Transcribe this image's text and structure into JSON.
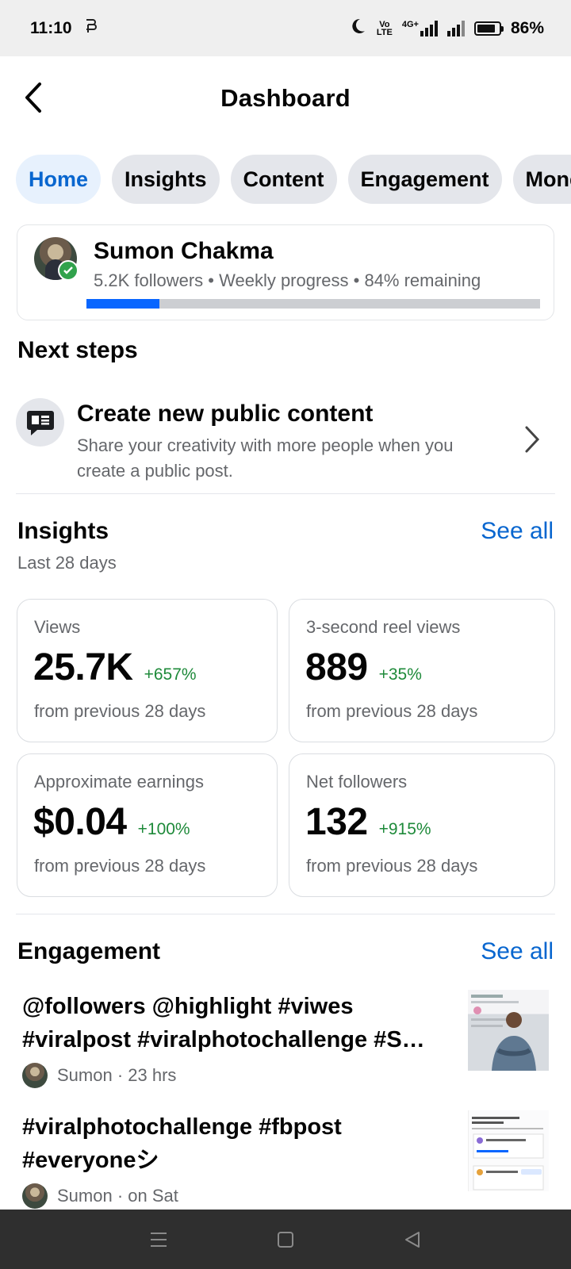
{
  "status_bar": {
    "time": "11:10",
    "volte": "Vo",
    "lte": "LTE",
    "network": "4G+",
    "battery": "86%",
    "battery_level": 0.86
  },
  "header": {
    "title": "Dashboard"
  },
  "tabs": [
    {
      "label": "Home",
      "active": true
    },
    {
      "label": "Insights",
      "active": false
    },
    {
      "label": "Content",
      "active": false
    },
    {
      "label": "Engagement",
      "active": false
    },
    {
      "label": "Mone",
      "active": false
    }
  ],
  "profile": {
    "name": "Sumon Chakma",
    "subtitle": "5.2K followers • Weekly progress • 84% remaining",
    "progress_fraction": 0.16
  },
  "next_steps": {
    "title": "Next steps",
    "item": {
      "title": "Create new public content",
      "description": "Share your creativity with more people when you create a public post."
    }
  },
  "insights": {
    "title": "Insights",
    "see_all": "See all",
    "period": "Last 28 days",
    "metrics": [
      {
        "label": "Views",
        "value": "25.7K",
        "change": "+657%",
        "foot": "from previous 28 days"
      },
      {
        "label": "3-second reel views",
        "value": "889",
        "change": "+35%",
        "foot": "from previous 28 days"
      },
      {
        "label": "Approximate earnings",
        "value": "$0.04",
        "change": "+100%",
        "foot": "from previous 28 days"
      },
      {
        "label": "Net followers",
        "value": "132",
        "change": "+915%",
        "foot": "from previous 28 days"
      }
    ]
  },
  "engagement": {
    "title": "Engagement",
    "see_all": "See all",
    "posts": [
      {
        "text_line1": "@followers @highlight #viwes",
        "text_line2": "#viralpost #viralphotochallenge #S…",
        "meta": "Sumon · 23 hrs"
      },
      {
        "text_line1": "#viralphotochallenge #fbpost",
        "text_line2": "#everyoneシ",
        "meta": "Sumon · on Sat"
      }
    ]
  },
  "colors": {
    "accent": "#0866ff",
    "link": "#0866cf",
    "positive": "#1e8a3a"
  }
}
